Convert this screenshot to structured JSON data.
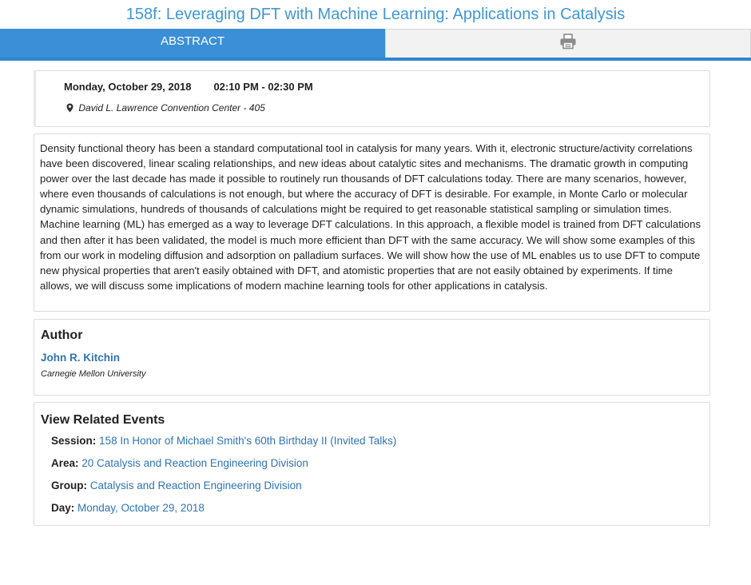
{
  "page": {
    "title": "158f: Leveraging DFT with Machine Learning: Applications in Catalysis"
  },
  "tabs": {
    "abstract_label": "ABSTRACT",
    "print_icon": "printer-icon"
  },
  "schedule": {
    "date": "Monday, October 29, 2018",
    "time": "02:10 PM - 02:30 PM",
    "location_icon": "map-marker-icon",
    "location": "David L. Lawrence Convention Center - 405"
  },
  "abstract": {
    "text": "Density functional theory has been a standard computational tool in catalysis for many years. With it, electronic structure/activity correlations have been discovered, linear scaling relationships, and new ideas about catalytic sites and mechanisms. The dramatic growth in computing power over the last decade has made it possible to routinely run thousands of DFT calculations today. There are many scenarios, however, where even thousands of calculations is not enough, but where the accuracy of DFT is desirable. For example, in Monte Carlo or molecular dynamic simulations, hundreds of thousands of calculations might be required to get reasonable statistical sampling or simulation times. Machine learning (ML) has emerged as a way to leverage DFT calculations. In this approach, a flexible model is trained from DFT calculations and then after it has been validated, the model is much more efficient than DFT with the same accuracy. We will show some examples of this from our work in modeling diffusion and adsorption on palladium surfaces. We will show how the use of ML enables us to use DFT to compute new physical properties that aren't easily obtained with DFT, and atomistic properties that are not easily obtained by experiments. If time allows, we will discuss some implications of modern machine learning tools for other applications in catalysis."
  },
  "author": {
    "heading": "Author",
    "name": "John R. Kitchin",
    "affiliation": "Carnegie Mellon University"
  },
  "related": {
    "heading": "View Related Events",
    "items": [
      {
        "label": "Session:",
        "value": "158 In Honor of Michael Smith's 60th Birthday II (Invited Talks)"
      },
      {
        "label": "Area:",
        "value": "20 Catalysis and Reaction Engineering Division"
      },
      {
        "label": "Group:",
        "value": "Catalysis and Reaction Engineering Division"
      },
      {
        "label": "Day:",
        "value": "Monday, October 29, 2018"
      }
    ]
  },
  "colors": {
    "accent": "#3a8fd6",
    "title": "#3f97d6",
    "link": "#2f74b5"
  }
}
